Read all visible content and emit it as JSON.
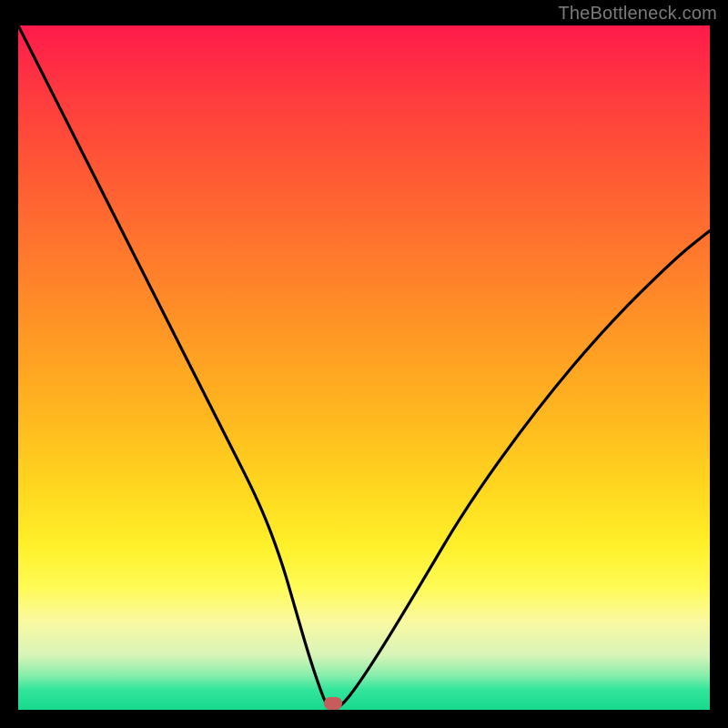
{
  "watermark": {
    "text": "TheBottleneck.com"
  },
  "colors": {
    "frame_bg": "#000000",
    "curve_stroke": "#000000",
    "marker_fill": "#c75c5c",
    "gradient_stops": [
      "#ff1a4b",
      "#ff3a3f",
      "#ff5a34",
      "#ff7a2c",
      "#ff9a24",
      "#ffba1f",
      "#ffd81f",
      "#fff02a",
      "#fffb55",
      "#faf9a0",
      "#d8f4b8",
      "#86eeab",
      "#33e59c",
      "#17d98e"
    ]
  },
  "chart_data": {
    "type": "line",
    "title": "",
    "xlabel": "",
    "ylabel": "",
    "xlim": [
      0,
      100
    ],
    "ylim": [
      0,
      100
    ],
    "categories": [
      0,
      2,
      5,
      10,
      15,
      20,
      25,
      30,
      35,
      38,
      40,
      42,
      44,
      45,
      46,
      48,
      52,
      58,
      65,
      75,
      85,
      95,
      100
    ],
    "series": [
      {
        "name": "bottleneck-curve",
        "values": [
          100,
          96,
          90,
          80,
          70,
          60,
          50,
          40,
          30,
          22,
          15,
          8,
          2,
          0,
          0,
          2,
          8,
          18,
          30,
          44,
          56,
          66,
          70
        ]
      }
    ],
    "marker": {
      "x": 45.5,
      "y": 0,
      "label": "optimal-point"
    }
  }
}
